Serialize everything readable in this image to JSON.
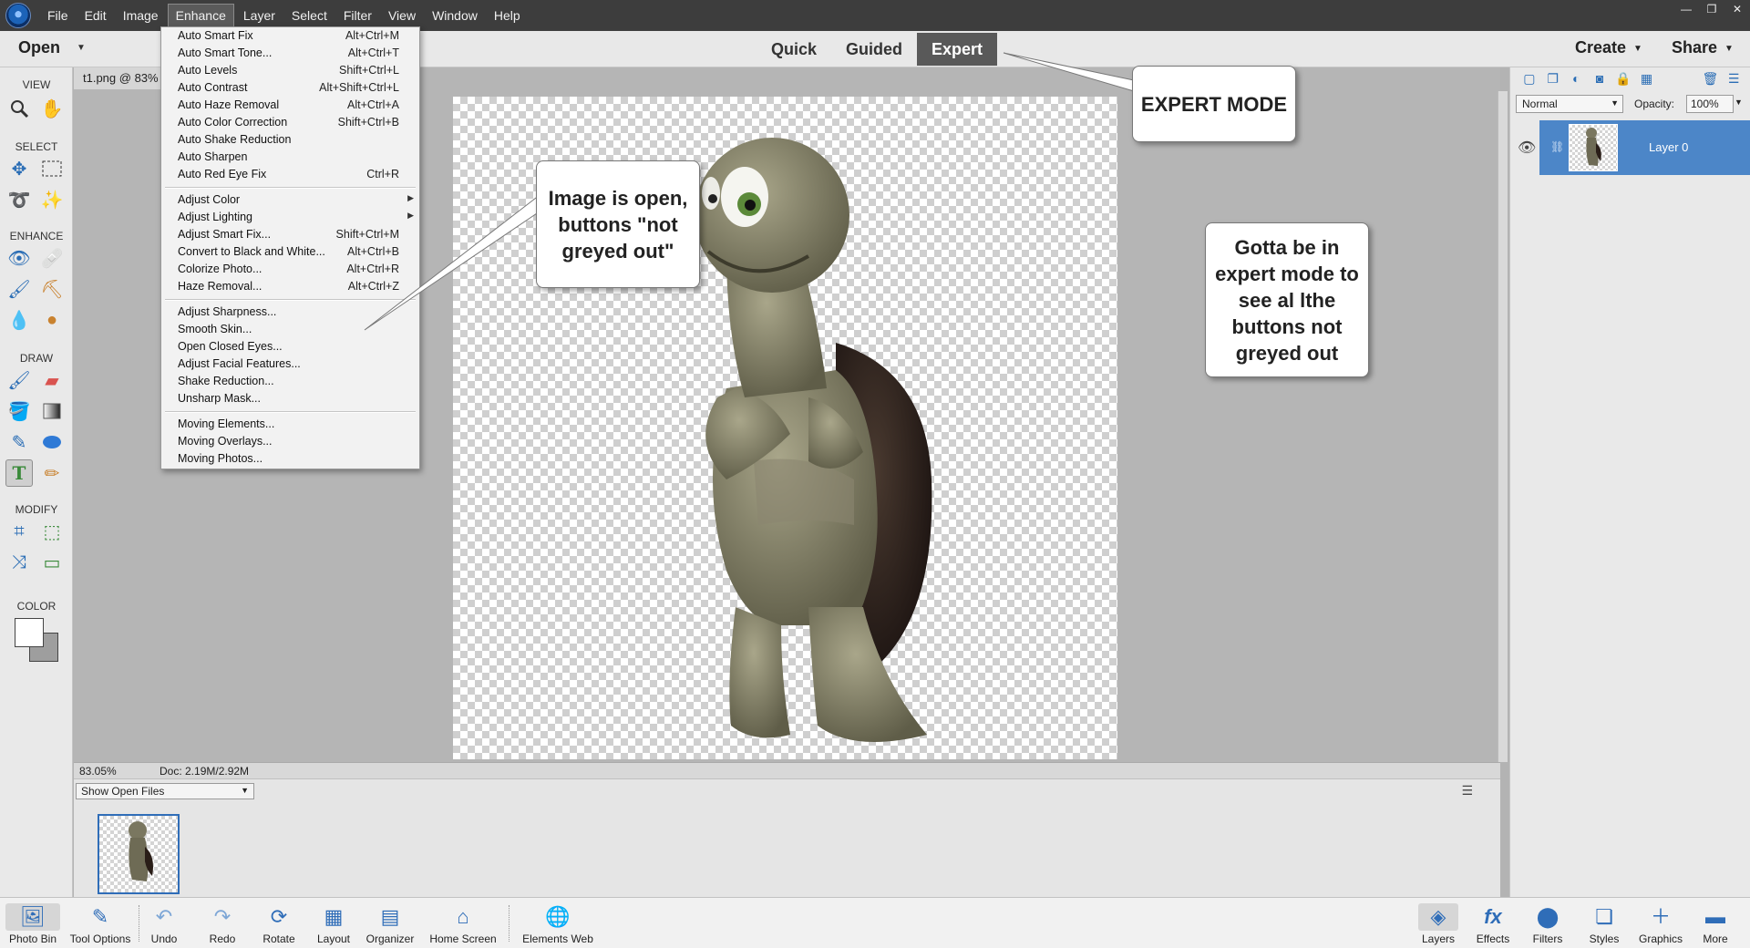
{
  "menubar": {
    "items": [
      "File",
      "Edit",
      "Image",
      "Enhance",
      "Layer",
      "Select",
      "Filter",
      "View",
      "Window",
      "Help"
    ],
    "active": "Enhance"
  },
  "window_controls": [
    "—",
    "❐",
    "✕"
  ],
  "topbar": {
    "open_label": "Open",
    "modes": [
      "Quick",
      "Guided",
      "Expert"
    ],
    "selected_mode": "Expert",
    "create_label": "Create",
    "share_label": "Share"
  },
  "toolbox": {
    "sections": [
      "VIEW",
      "SELECT",
      "ENHANCE",
      "DRAW",
      "MODIFY",
      "COLOR"
    ]
  },
  "document": {
    "tab_title": "t1.png @ 83%"
  },
  "statusbar": {
    "zoom": "83.05%",
    "doc_size": "Doc: 2.19M/2.92M"
  },
  "photobin": {
    "show_files": "Show Open Files"
  },
  "layers_panel": {
    "blend_mode": "Normal",
    "opacity_label": "Opacity:",
    "opacity_value": "100%",
    "layer_name": "Layer 0"
  },
  "taskbar": {
    "left": [
      "Photo Bin",
      "Tool Options",
      "Undo",
      "Redo",
      "Rotate",
      "Layout",
      "Organizer",
      "Home Screen",
      "Elements Web"
    ],
    "right": [
      "Layers",
      "Effects",
      "Filters",
      "Styles",
      "Graphics",
      "More"
    ]
  },
  "enhance_menu": [
    {
      "label": "Auto Smart Fix",
      "shortcut": "Alt+Ctrl+M"
    },
    {
      "label": "Auto Smart Tone...",
      "shortcut": "Alt+Ctrl+T"
    },
    {
      "label": "Auto Levels",
      "shortcut": "Shift+Ctrl+L"
    },
    {
      "label": "Auto Contrast",
      "shortcut": "Alt+Shift+Ctrl+L"
    },
    {
      "label": "Auto Haze Removal",
      "shortcut": "Alt+Ctrl+A"
    },
    {
      "label": "Auto Color Correction",
      "shortcut": "Shift+Ctrl+B"
    },
    {
      "label": "Auto Shake Reduction",
      "shortcut": ""
    },
    {
      "label": "Auto Sharpen",
      "shortcut": ""
    },
    {
      "label": "Auto Red Eye Fix",
      "shortcut": "Ctrl+R"
    },
    {
      "label": "Adjust Color",
      "shortcut": "",
      "submenu": true
    },
    {
      "label": "Adjust Lighting",
      "shortcut": "",
      "submenu": true
    },
    {
      "label": "Adjust Smart Fix...",
      "shortcut": "Shift+Ctrl+M"
    },
    {
      "label": "Convert to Black and White...",
      "shortcut": "Alt+Ctrl+B"
    },
    {
      "label": "Colorize Photo...",
      "shortcut": "Alt+Ctrl+R"
    },
    {
      "label": "Haze Removal...",
      "shortcut": "Alt+Ctrl+Z"
    },
    {
      "label": "Adjust Sharpness...",
      "shortcut": ""
    },
    {
      "label": "Smooth Skin...",
      "shortcut": ""
    },
    {
      "label": "Open Closed Eyes...",
      "shortcut": ""
    },
    {
      "label": "Adjust Facial Features...",
      "shortcut": ""
    },
    {
      "label": "Shake Reduction...",
      "shortcut": ""
    },
    {
      "label": "Unsharp Mask...",
      "shortcut": ""
    },
    {
      "label": "Moving Elements...",
      "shortcut": ""
    },
    {
      "label": "Moving Overlays...",
      "shortcut": ""
    },
    {
      "label": "Moving Photos...",
      "shortcut": ""
    }
  ],
  "callouts": {
    "expert_mode": "EXPERT MODE",
    "image_open": "Image is open, buttons \"not greyed out\"",
    "gotta_be": "Gotta be in expert mode to see al lthe buttons not greyed out"
  },
  "colors": {
    "accent": "#2f6db8",
    "layer_selected": "#4c86c8",
    "mode_selected_bg": "#595959"
  }
}
